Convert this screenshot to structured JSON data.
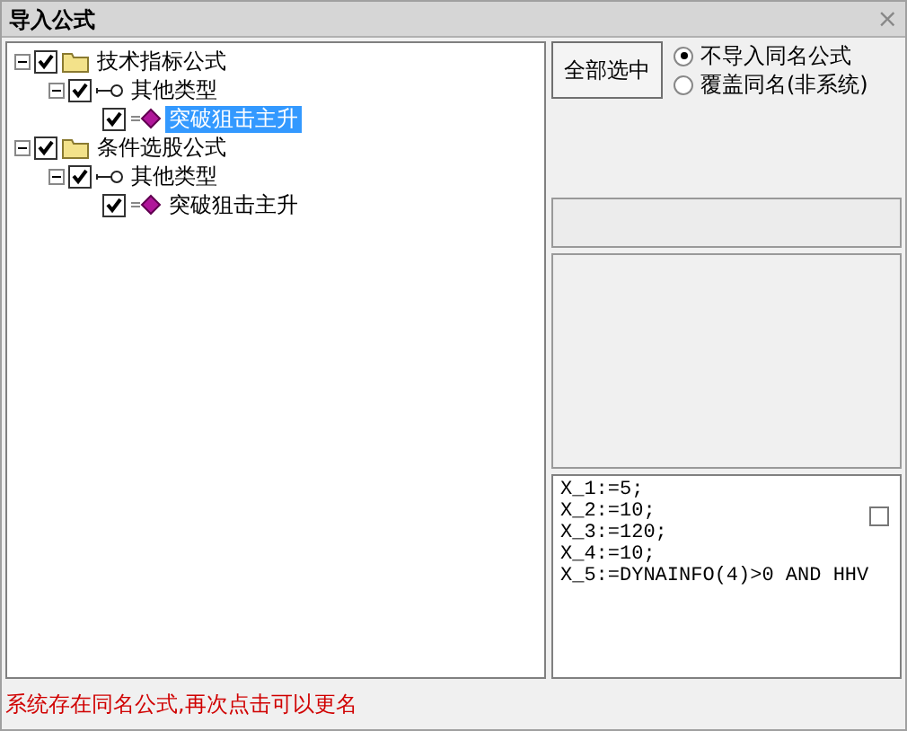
{
  "window": {
    "title": "导入公式",
    "close": "×"
  },
  "tree": [
    {
      "label": "技术指标公式",
      "kind": "folder",
      "checked": true,
      "expanded": true,
      "selected": false,
      "children": [
        {
          "label": "其他类型",
          "kind": "group",
          "checked": true,
          "expanded": true,
          "selected": false,
          "children": [
            {
              "label": "突破狙击主升",
              "kind": "formula",
              "checked": true,
              "selected": true
            }
          ]
        }
      ]
    },
    {
      "label": "条件选股公式",
      "kind": "folder",
      "checked": true,
      "expanded": true,
      "selected": false,
      "children": [
        {
          "label": "其他类型",
          "kind": "group",
          "checked": true,
          "expanded": true,
          "selected": false,
          "children": [
            {
              "label": "突破狙击主升",
              "kind": "formula",
              "checked": true,
              "selected": false
            }
          ]
        }
      ]
    }
  ],
  "select_all_button": "全部选中",
  "options": [
    {
      "label": "不导入同名公式",
      "selected": true
    },
    {
      "label": "覆盖同名(非系统)",
      "selected": false
    }
  ],
  "code_lines": [
    "X_1:=5;",
    "X_2:=10;",
    "X_3:=120;",
    "X_4:=10;",
    "X_5:=DYNAINFO(4)>0 AND HHV"
  ],
  "code_checkbox": {
    "checked": false
  },
  "status_bar": "系统存在同名公式,再次点击可以更名"
}
